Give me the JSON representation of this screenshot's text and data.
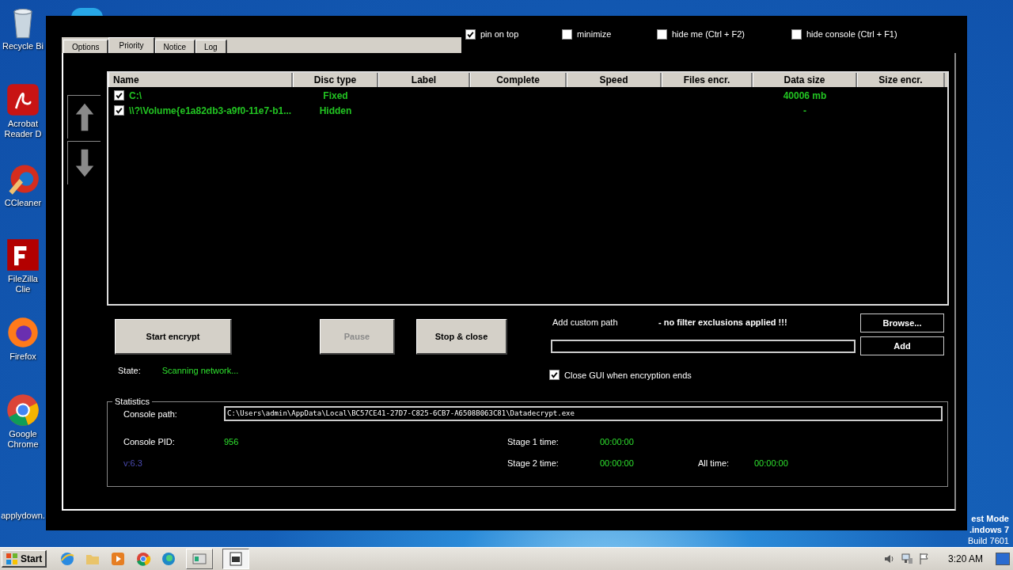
{
  "desktop": {
    "icons": [
      {
        "label": "Recycle Bi",
        "kind": "bin"
      },
      {
        "label": "Acrobat Reader D",
        "kind": "acrobat"
      },
      {
        "label": "CCleaner",
        "kind": "cleaner"
      },
      {
        "label": "FileZilla Clie",
        "kind": "filezilla"
      },
      {
        "label": "Firefox",
        "kind": "firefox"
      },
      {
        "label": "Google Chrome",
        "kind": "chrome"
      },
      {
        "label": "applydown.",
        "kind": "blank"
      }
    ],
    "os_text": [
      "est Mode",
      ".indows 7",
      "Build 7601"
    ]
  },
  "window": {
    "tabs": [
      {
        "label": "Options",
        "selected": false
      },
      {
        "label": "Priority",
        "selected": true
      },
      {
        "label": "Notice",
        "selected": false
      },
      {
        "label": "Log",
        "selected": false
      }
    ],
    "top_options": [
      {
        "label": "pin on top",
        "checked": true
      },
      {
        "label": "minimize",
        "checked": false
      },
      {
        "label": "hide me (Ctrl + F2)",
        "checked": false
      },
      {
        "label": "hide console (Ctrl + F1)",
        "checked": false
      }
    ],
    "table": {
      "columns": [
        "Name",
        "Disc type",
        "Label",
        "Complete",
        "Speed",
        "Files encr.",
        "Data size",
        "Size encr."
      ],
      "rows": [
        {
          "checked": true,
          "name": "C:\\",
          "disc_type": "Fixed",
          "data_size": "40006 mb"
        },
        {
          "checked": true,
          "name": "\\\\?\\Volume{e1a82db3-a9f0-11e7-b1...",
          "disc_type": "Hidden",
          "data_size": "-"
        }
      ]
    },
    "buttons": [
      {
        "label": "Start encrypt",
        "disabled": false
      },
      {
        "label": "Pause",
        "disabled": true
      },
      {
        "label": "Stop & close",
        "disabled": false
      }
    ],
    "custom_path": {
      "label": "Add custom path",
      "note": "- no filter exclusions applied !!!",
      "browse": "Browse...",
      "add": "Add"
    },
    "state": {
      "label": "State:",
      "value": "Scanning network..."
    },
    "close_gui": {
      "label": "Close GUI when encryption ends",
      "checked": true
    },
    "statistics": {
      "title": "Statistics",
      "console_path_label": "Console path:",
      "console_path": "C:\\Users\\admin\\AppData\\Local\\BC57CE41-27D7-C825-6CB7-A6508B063C81\\Datadecrypt.exe",
      "pid_label": "Console PID:",
      "pid": "956",
      "version": "v:6.3",
      "stage1_label": "Stage 1 time:",
      "stage1": "00:00:00",
      "stage2_label": "Stage 2 time:",
      "stage2": "00:00:00",
      "all_label": "All time:",
      "all": "00:00:00"
    }
  },
  "taskbar": {
    "start": "Start",
    "clock": "3:20 AM"
  }
}
